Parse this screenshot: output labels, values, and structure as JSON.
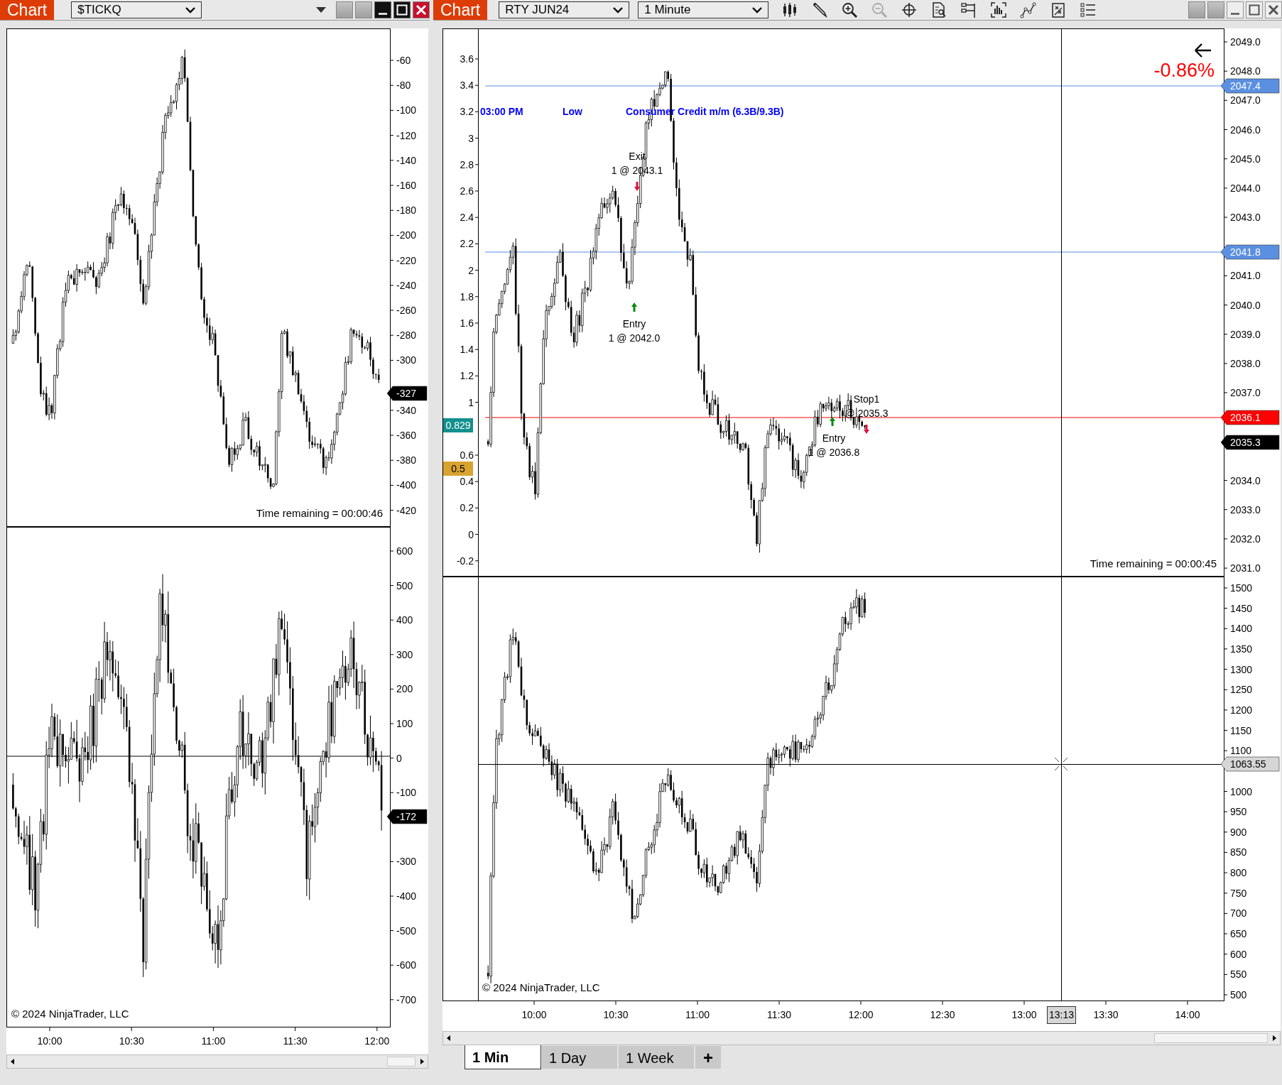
{
  "windows": [
    {
      "tab": "Chart",
      "instrument": "$TICKQ",
      "panels": [
        {
          "axis_ticks": [
            "-60",
            "-80",
            "-100",
            "-120",
            "-140",
            "-160",
            "-180",
            "-200",
            "-220",
            "-240",
            "-260",
            "-280",
            "-300",
            "-340",
            "-360",
            "-380",
            "-400",
            "-420"
          ],
          "markers": [
            {
              "label": "-327",
              "color": "#000000"
            }
          ],
          "time_remaining": "Time remaining = 00:00:46"
        },
        {
          "axis_ticks": [
            "600",
            "500",
            "400",
            "300",
            "200",
            "100",
            "0",
            "-100",
            "-300",
            "-400",
            "-500",
            "-600",
            "-700"
          ],
          "markers": [
            {
              "label": "-172",
              "color": "#000000"
            }
          ],
          "copyright": "© 2024 NinjaTrader, LLC"
        }
      ],
      "time_ticks": [
        "10:00",
        "10:30",
        "11:00",
        "11:30",
        "12:00"
      ]
    },
    {
      "tab": "Chart",
      "instrument": "RTY JUN24",
      "interval": "1 Minute",
      "panels": [
        {
          "axis_ticks": [
            "2049.0",
            "2048.0",
            "2047.0",
            "2046.0",
            "2045.0",
            "2044.0",
            "2043.0",
            "2041.0",
            "2040.0",
            "2039.0",
            "2038.0",
            "2037.0",
            "2034.0",
            "2033.0",
            "2032.0",
            "2031.0"
          ],
          "left_axis_ticks": [
            "3.6",
            "3.4",
            "3.2",
            "3",
            "2.8",
            "2.6",
            "2.4",
            "2.2",
            "2",
            "1.8",
            "1.6",
            "1.4",
            "1.2",
            "1",
            "0.6",
            "0.4",
            "0.2",
            "0",
            "-0.2"
          ],
          "markers": [
            {
              "label": "2047.4",
              "color": "#5b8fe0"
            },
            {
              "label": "2041.8",
              "color": "#5b8fe0"
            },
            {
              "label": "2036.1",
              "color": "#ff0000"
            },
            {
              "label": "2035.3",
              "color": "#000000"
            }
          ],
          "left_markers": [
            {
              "label": "0.829",
              "color": "#12908e"
            },
            {
              "label": "0.5",
              "color": "#d9a330"
            }
          ],
          "events": [
            "03:00 PM",
            "Low",
            "Consumer Credit m/m (6.3B/9.3B)"
          ],
          "trades": [
            {
              "kind": "exit",
              "action": "Exit",
              "fill": "1 @ 2043.1"
            },
            {
              "kind": "entry",
              "action": "Entry",
              "fill": "1 @ 2042.0"
            },
            {
              "kind": "stop",
              "action": "Stop1",
              "fill": "@ 2035.3"
            },
            {
              "kind": "entry",
              "action": "Entry",
              "fill": "1 @ 2036.8"
            }
          ],
          "change": "-0.86%",
          "time_remaining": "Time remaining = 00:00:45"
        },
        {
          "axis_ticks": [
            "1500",
            "1450",
            "1400",
            "1350",
            "1300",
            "1250",
            "1200",
            "1150",
            "1100",
            "1000",
            "950",
            "900",
            "850",
            "800",
            "750",
            "700",
            "650",
            "600",
            "550",
            "500"
          ],
          "markers": [
            {
              "label": "1063.55",
              "color": "#d6d6d6"
            }
          ],
          "copyright": "© 2024 NinjaTrader, LLC"
        }
      ],
      "time_ticks": [
        "10:00",
        "10:30",
        "11:00",
        "11:30",
        "12:00",
        "12:30",
        "13:00",
        "13:30",
        "14:00"
      ],
      "crosshair_time": "13:13",
      "tabs": [
        {
          "label": "1 Min",
          "selected": true
        },
        {
          "label": "1 Day",
          "selected": false
        },
        {
          "label": "1 Week",
          "selected": false
        }
      ],
      "add_tab": "+"
    }
  ]
}
